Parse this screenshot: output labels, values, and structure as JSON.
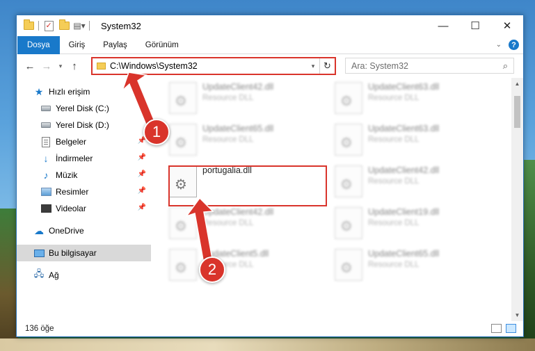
{
  "window": {
    "title": "System32",
    "controls": {
      "minimize": "—",
      "maximize": "☐",
      "close": "✕"
    }
  },
  "ribbon": {
    "tabs": [
      {
        "label": "Dosya",
        "active": true
      },
      {
        "label": "Giriş",
        "active": false
      },
      {
        "label": "Paylaş",
        "active": false
      },
      {
        "label": "Görünüm",
        "active": false
      }
    ],
    "help": "?"
  },
  "address": {
    "path": "C:\\Windows\\System32",
    "search_placeholder": "Ara: System32"
  },
  "nav": {
    "quick_access": "Hızlı erişim",
    "items": [
      {
        "label": "Yerel Disk (C:)",
        "icon": "drive-icon",
        "pinned": false
      },
      {
        "label": "Yerel Disk (D:)",
        "icon": "drive-icon",
        "pinned": false
      },
      {
        "label": "Belgeler",
        "icon": "documents-icon",
        "pinned": true
      },
      {
        "label": "İndirmeler",
        "icon": "downloads-icon",
        "pinned": true
      },
      {
        "label": "Müzik",
        "icon": "music-icon",
        "pinned": true
      },
      {
        "label": "Resimler",
        "icon": "pictures-icon",
        "pinned": true
      },
      {
        "label": "Videolar",
        "icon": "videos-icon",
        "pinned": true
      }
    ],
    "onedrive": "OneDrive",
    "this_pc": "Bu bilgisayar",
    "network": "Ağ"
  },
  "files": [
    {
      "name": "UpdateClient42.dll",
      "desc": "Resource DLL"
    },
    {
      "name": "UpdateClient63.dll",
      "desc": "Resource DLL"
    },
    {
      "name": "UpdateClient65.dll",
      "desc": "Resource DLL"
    },
    {
      "name": "UpdateClient63.dll",
      "desc": "Resource DLL"
    },
    {
      "name": "portugalia.dll",
      "desc": ""
    },
    {
      "name": "UpdateClient42.dll",
      "desc": "Resource DLL"
    },
    {
      "name": "UpdateClient42.dll",
      "desc": "Resource DLL"
    },
    {
      "name": "UpdateClient19.dll",
      "desc": "Resource DLL"
    },
    {
      "name": "UpdateClient5.dll",
      "desc": "Resource DLL"
    },
    {
      "name": "UpdateClient65.dll",
      "desc": "Resource DLL"
    }
  ],
  "status": {
    "count": "136 öğe"
  },
  "annotations": {
    "step1": "1",
    "step2": "2",
    "color": "#d9342b"
  }
}
